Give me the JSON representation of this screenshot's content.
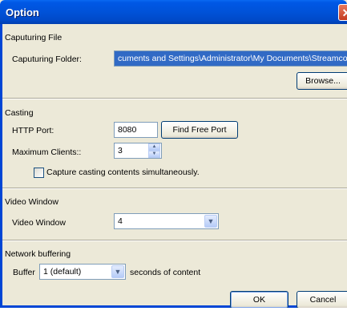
{
  "window": {
    "title": "Option",
    "close_glyph": "✕"
  },
  "capturing": {
    "section_label": "Caputuring File",
    "folder_label": "Caputuring Folder:",
    "folder_value": "cuments and Settings\\Administrator\\My Documents\\Streamcode",
    "browse_label": "Browse..."
  },
  "casting": {
    "section_label": "Casting",
    "port_label": "HTTP Port:",
    "port_value": "8080",
    "find_port_label": "Find Free Port",
    "max_clients_label": "Maximum Clients::",
    "max_clients_value": "3",
    "capture_checkbox_label": "Capture casting contents simultaneously.",
    "capture_checked": false
  },
  "video": {
    "section_label": "Video Window",
    "window_label": "Video Window",
    "window_value": "4"
  },
  "network": {
    "section_label": "Network buffering",
    "buffer_label": "Buffer",
    "buffer_value": "1 (default)",
    "buffer_suffix": "seconds of content"
  },
  "footer": {
    "ok_label": "OK",
    "cancel_label": "Cancel"
  },
  "icons": {
    "dropdown": "chevron-down-icon",
    "spin_up": "arrow-up-icon",
    "spin_down": "arrow-down-icon",
    "close": "close-icon"
  },
  "colors": {
    "titlebar": "#0052d8",
    "dialog_bg": "#ece9d8",
    "selection": "#316ac5",
    "close_button": "#c43a1f"
  }
}
